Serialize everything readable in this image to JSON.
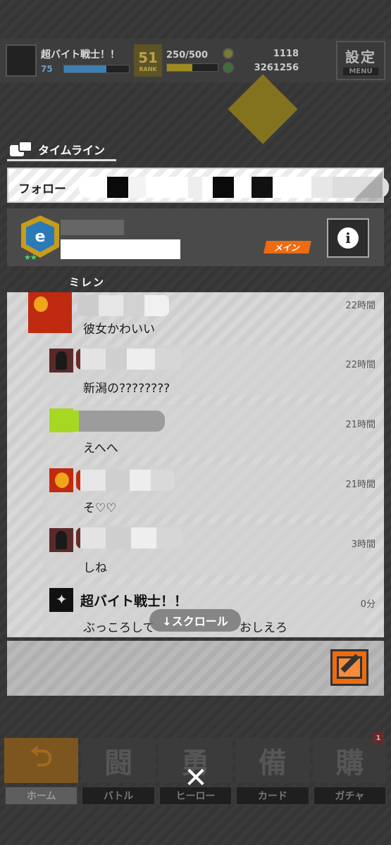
{
  "topbar": {
    "player_name": "超バイト戦士！！",
    "level": "75",
    "rank_number": "51",
    "rank_label": "RANK",
    "xp": "250/500",
    "coins": "1118",
    "money": "3261256",
    "settings_label": "設定",
    "menu_label": "MENU",
    "colors": {
      "level_bar": "#3d7fb0",
      "xp_bar": "#9e8a1e"
    }
  },
  "timeline": {
    "title": "タイムライン",
    "follow_label": "フォロー",
    "main_badge": "メイン",
    "info_icon": "i",
    "ghost_text": "ミレン"
  },
  "posts": [
    {
      "avatar": "red-hero-avatar",
      "time": "22時間",
      "message": "彼女かわいい"
    },
    {
      "avatar": "dark-hood-avatar",
      "time": "22時間",
      "message": "新潟の????????"
    },
    {
      "avatar": "green-avatar",
      "time": "21時間",
      "message": "えへへ"
    },
    {
      "avatar": "red-hero-avatar",
      "time": "21時間",
      "message": "そ♡♡"
    },
    {
      "avatar": "dark-hood-avatar",
      "time": "3時間",
      "message": "しね"
    },
    {
      "avatar": "robot-avatar",
      "name": "超バイト戦士！！",
      "time": "0分",
      "message": "ぶっころして",
      "message_tail": "おしえろ"
    }
  ],
  "scroll_hint": "↓スクロール",
  "bottom_nav": [
    {
      "label": "ホーム",
      "icon": "home-icon",
      "glyph": "⮌",
      "active": true
    },
    {
      "label": "バトル",
      "icon": "battle-icon",
      "glyph": "闘",
      "active": false
    },
    {
      "label": "ヒーロー",
      "icon": "hero-icon",
      "glyph": "勇",
      "active": false
    },
    {
      "label": "カード",
      "icon": "card-icon",
      "glyph": "備",
      "active": false
    },
    {
      "label": "ガチャ",
      "icon": "gacha-icon",
      "glyph": "購",
      "active": false,
      "badge": "1"
    }
  ],
  "close_glyph": "✕"
}
